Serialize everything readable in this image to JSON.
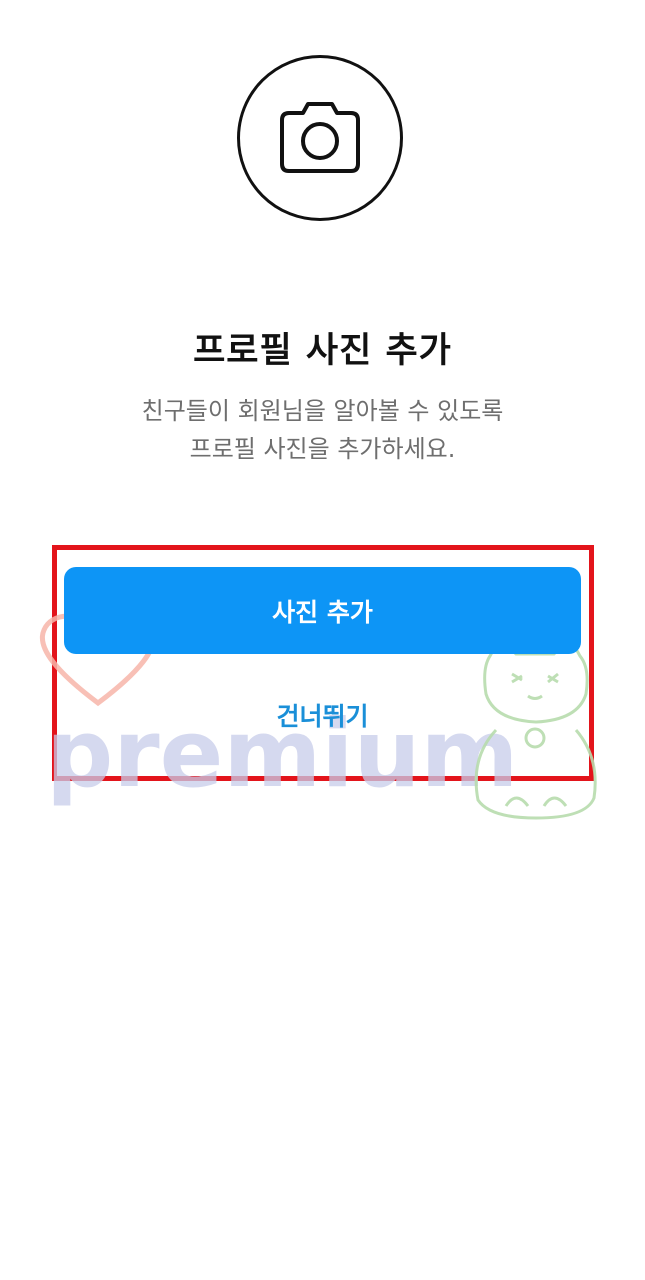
{
  "profile": {
    "camera_icon": "camera-icon",
    "title": "프로필 사진 추가",
    "subtitle_line1": "친구들이 회원님을 알아볼 수 있도록",
    "subtitle_line2": "프로필 사진을 추가하세요."
  },
  "actions": {
    "add_photo_label": "사진 추가",
    "skip_label": "건너뛰기"
  },
  "watermark": {
    "text": "premium",
    "icons": [
      "heart-icon",
      "lucky-cat-icon"
    ]
  },
  "colors": {
    "primary": "#0d95f6",
    "link": "#1a8fd8",
    "highlight": "#e3141b",
    "title": "#111111",
    "subtitle": "#6e6e6e"
  }
}
